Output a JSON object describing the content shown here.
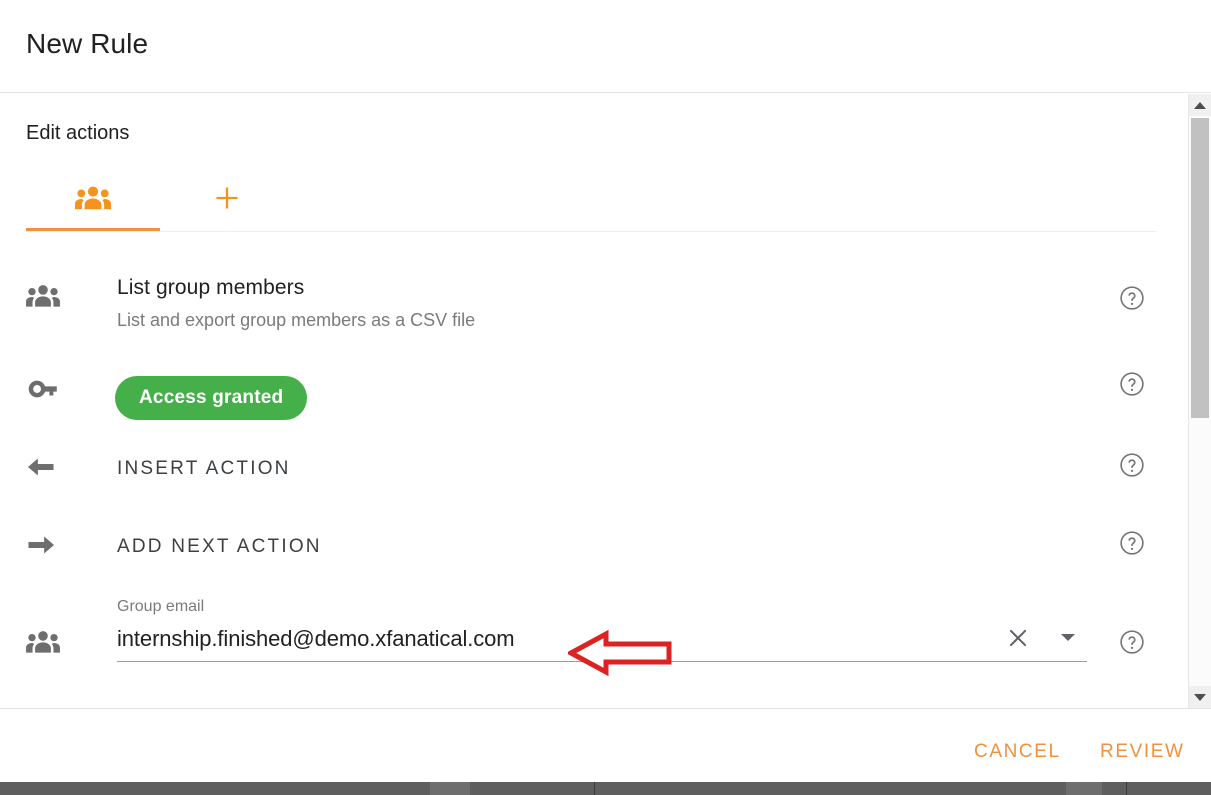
{
  "header": {
    "title": "New Rule"
  },
  "section": {
    "title": "Edit actions"
  },
  "tabs": [
    {
      "name": "groups-tab",
      "icon": "groups-icon",
      "label": "",
      "active": true
    },
    {
      "name": "add-tab",
      "icon": "plus-icon",
      "label": "",
      "active": false
    }
  ],
  "rows": [
    {
      "leading_icon": "groups-icon",
      "title": "List group members",
      "subtitle": "List and export group members as a CSV file",
      "help_icon": "help-circle-icon"
    },
    {
      "leading_icon": "key-icon",
      "chip_label": "Access granted",
      "chip_color": "#45b04a",
      "help_icon": "help-circle-icon"
    },
    {
      "leading_icon": "arrow-left-icon",
      "action_label": "INSERT ACTION",
      "help_icon": "help-circle-icon"
    },
    {
      "leading_icon": "arrow-right-icon",
      "action_label": "ADD NEXT ACTION",
      "help_icon": "help-circle-icon"
    },
    {
      "leading_icon": "groups-icon",
      "field_label": "Group email",
      "field_value": "internship.finished@demo.xfanatical.com",
      "field_placeholder": "Group email",
      "clear_icon": "close-icon",
      "dropdown_icon": "chevron-down-icon",
      "help_icon": "help-circle-icon"
    }
  ],
  "footer": {
    "cancel_label": "CANCEL",
    "review_label": "REVIEW"
  },
  "annotation": {
    "type": "arrow-left",
    "color": "#dd2222"
  },
  "colors": {
    "accent": "#ef9240",
    "success": "#45b04a",
    "text_primary": "#202124",
    "text_secondary": "#7b7b7b",
    "annotation_red": "#dd2222"
  },
  "scrollbar": {
    "up_icon": "triangle-up-icon",
    "down_icon": "triangle-down-icon"
  }
}
